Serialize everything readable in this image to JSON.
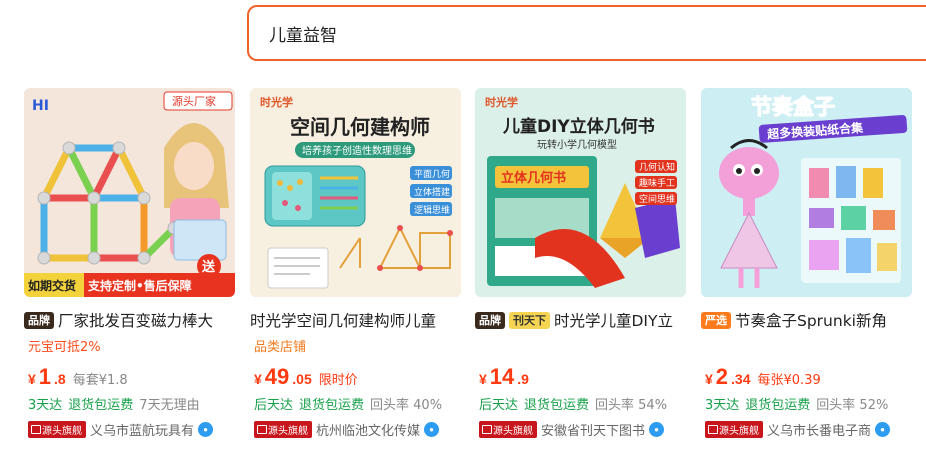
{
  "search": {
    "value": "儿童益智"
  },
  "products": [
    {
      "tags": [
        {
          "text": "品牌",
          "style": "dark"
        }
      ],
      "title": "厂家批发百变磁力棒大",
      "sub": {
        "text": "元宝可抵2%",
        "style": "red"
      },
      "price": {
        "currency": "¥",
        "int": "1",
        "dec": ".8",
        "note": "每套¥1.8",
        "note_color": "#888888"
      },
      "services": [
        {
          "text": "3天达",
          "style": "green"
        },
        {
          "text": "退货包运费",
          "style": "green"
        },
        {
          "text": "7天无理由",
          "style": "gray"
        }
      ],
      "shop": {
        "badge": "源头旗舰",
        "name": "义乌市蓝航玩具有"
      },
      "image": {
        "bg": "#f3e3d6",
        "brand": "HI",
        "corner_tag": "源头厂家",
        "bottom_left": "如期交货",
        "bottom_right": "支持定制•售后保障",
        "side_text": "送"
      }
    },
    {
      "tags": [],
      "title": "时光学空间几何建构师儿童",
      "sub": {
        "text": "品类店铺",
        "style": "orange"
      },
      "price": {
        "currency": "¥",
        "int": "49",
        "dec": ".05",
        "note": "限时价",
        "note_color": "#ff3a10"
      },
      "services": [
        {
          "text": "后天达",
          "style": "green"
        },
        {
          "text": "退货包运费",
          "style": "green"
        },
        {
          "text": "回头率 40%",
          "style": "gray"
        }
      ],
      "shop": {
        "badge": "源头旗舰",
        "name": "杭州临池文化传媒"
      },
      "image": {
        "bg": "#f6ecd8",
        "brand": "时光学",
        "headline": "空间几何建构师",
        "subline": "培养孩子创造性数理思维",
        "labels": [
          "平面几何",
          "立体搭建",
          "逻辑思维"
        ]
      }
    },
    {
      "tags": [
        {
          "text": "品牌",
          "style": "dark"
        },
        {
          "text": "刊天下",
          "style": "tiantian"
        }
      ],
      "title": "时光学儿童DIY立",
      "sub": {
        "text": "",
        "style": "red"
      },
      "price": {
        "currency": "¥",
        "int": "14",
        "dec": ".9",
        "note": "",
        "note_color": "#888888"
      },
      "services": [
        {
          "text": "后天达",
          "style": "green"
        },
        {
          "text": "退货包运费",
          "style": "green"
        },
        {
          "text": "回头率 54%",
          "style": "gray"
        }
      ],
      "shop": {
        "badge": "源头旗舰",
        "name": "安徽省刊天下图书"
      },
      "image": {
        "bg": "#d9efe9",
        "brand": "时光学",
        "headline": "儿童DIY立体几何书",
        "subline": "玩转小学几何模型",
        "book_title": "立体几何书",
        "labels": [
          "几何认知",
          "趣味手工",
          "空间思维"
        ]
      }
    },
    {
      "tags": [
        {
          "text": "严选",
          "style": "orange"
        }
      ],
      "title": "节奏盒子Sprunki新角",
      "sub": {
        "text": "",
        "style": "red"
      },
      "price": {
        "currency": "¥",
        "int": "2",
        "dec": ".34",
        "note": "每张¥0.39",
        "note_color": "#ff3a10"
      },
      "services": [
        {
          "text": "3天达",
          "style": "green"
        },
        {
          "text": "退货包运费",
          "style": "green"
        },
        {
          "text": "回头率 52%",
          "style": "gray"
        }
      ],
      "shop": {
        "badge": "源头旗舰",
        "name": "义乌市长番电子商"
      },
      "image": {
        "bg": "#c9eef3",
        "headline": "节奏盒子",
        "subline": "超多换装贴纸合集"
      }
    }
  ]
}
